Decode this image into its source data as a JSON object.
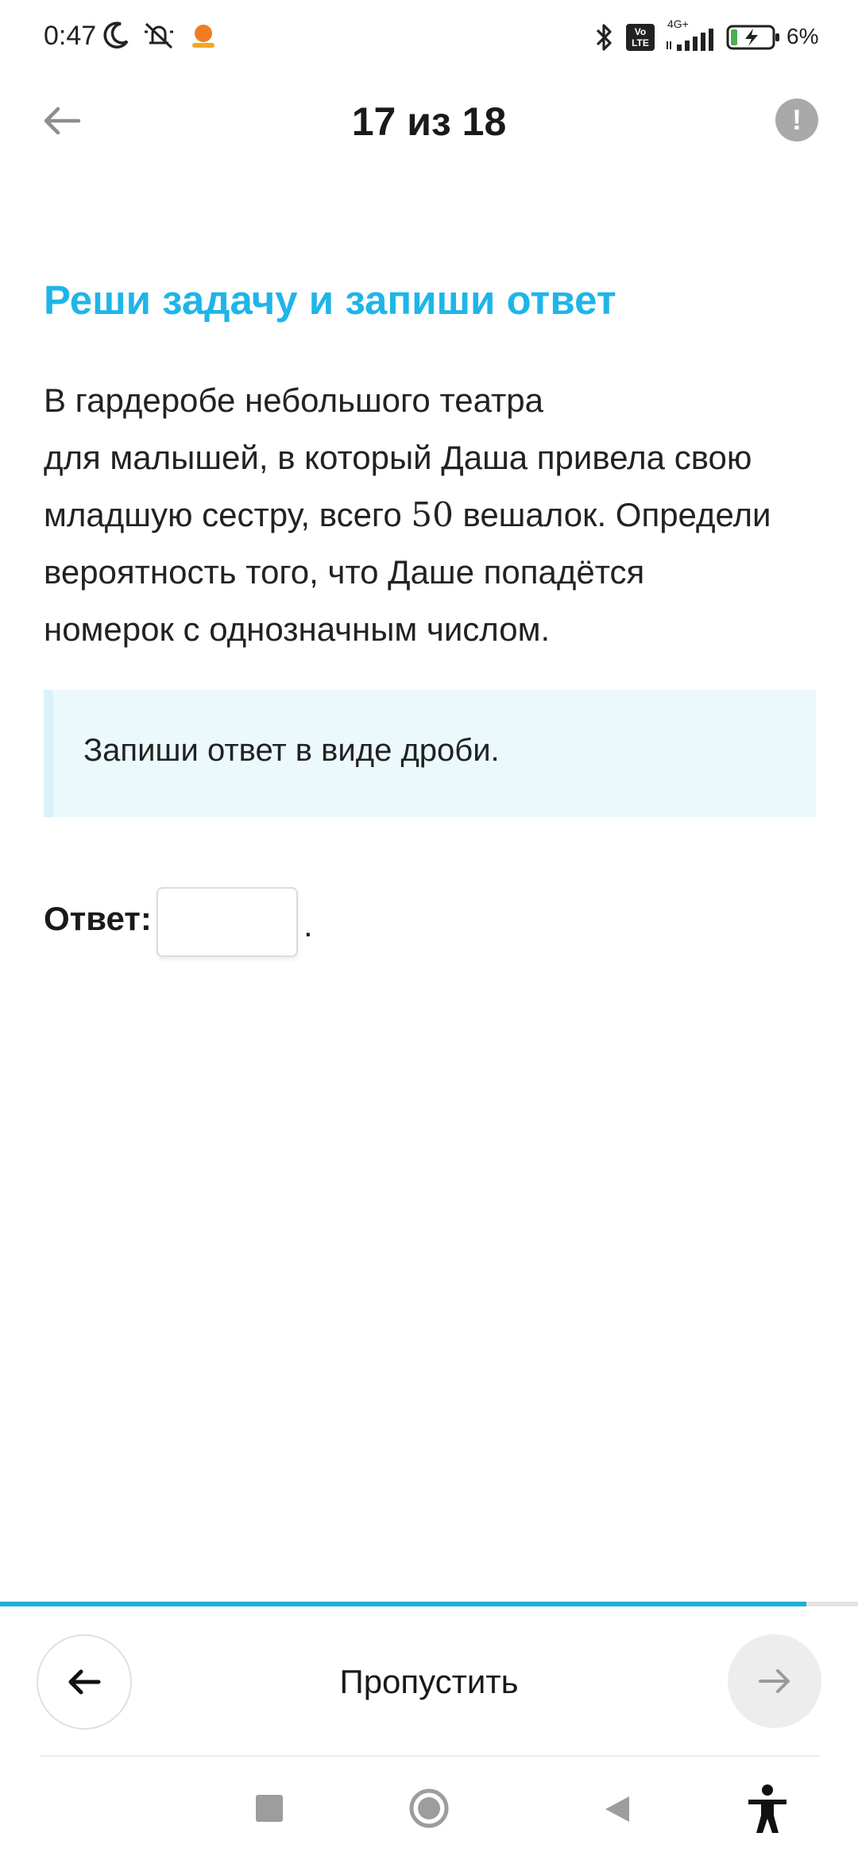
{
  "status_bar": {
    "time": "0:47",
    "network": "4G+",
    "volte": "Vo LTE",
    "battery": "6%",
    "icons": [
      "moon-icon",
      "mute-icon",
      "app-notification-icon",
      "bluetooth-icon",
      "volte-icon",
      "signal-icon",
      "battery-charging-icon"
    ]
  },
  "header": {
    "counter": "17 из 18",
    "back_icon": "arrow-left-icon",
    "report_icon": "exclamation-icon",
    "report_symbol": "!"
  },
  "task": {
    "title": "Реши задачу и запиши ответ",
    "line1": "В гардеробе небольшого театра",
    "line2": "для малышей, в который Даша привела свою",
    "line3_pre": "младшую сестру, всего ",
    "line3_num": "50",
    "line3_post": " вешалок. Определи",
    "line4": "вероятность того, что Даше попадётся",
    "line5": "номерок с однозначным числом."
  },
  "hint": {
    "text": "Запиши ответ в виде дроби."
  },
  "answer": {
    "label": "Ответ:",
    "value": "",
    "suffix": "."
  },
  "progress": {
    "fraction": 0.94,
    "color": "#1eb0d6"
  },
  "bottom_nav": {
    "skip_label": "Пропустить",
    "prev_icon": "arrow-left-icon",
    "next_icon": "arrow-right-icon"
  },
  "system_nav": {
    "icons": [
      "recents-square-icon",
      "home-circle-icon",
      "back-triangle-icon",
      "accessibility-icon"
    ]
  },
  "colors": {
    "accent": "#1eb5e8",
    "hint_background": "#ebf9fd"
  }
}
